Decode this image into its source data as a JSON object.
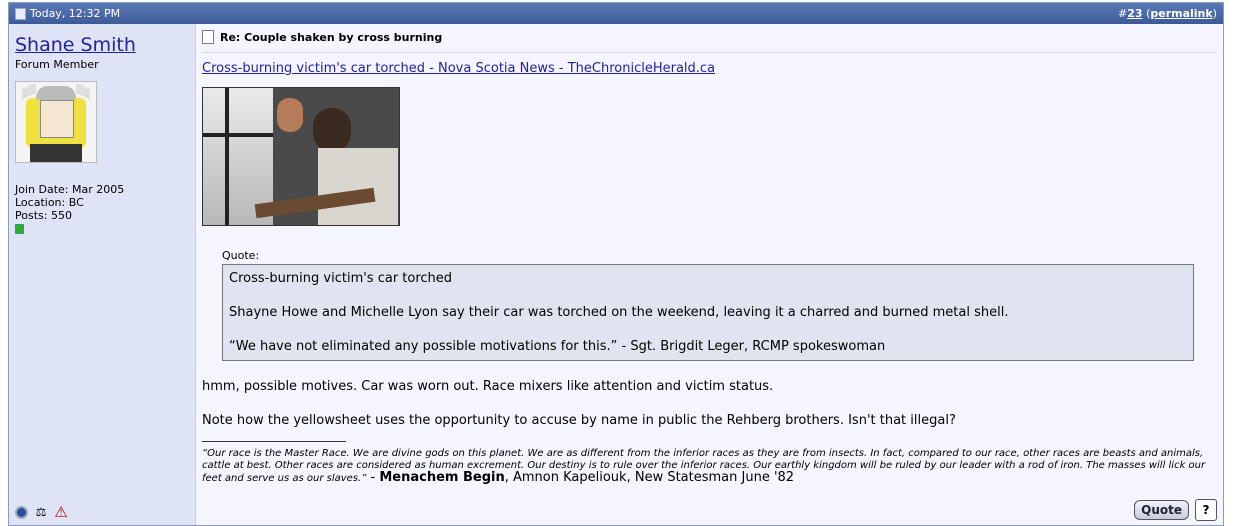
{
  "header": {
    "date": "Today, 12:32 PM",
    "hash": "#",
    "post_number": "23",
    "open_paren": "(",
    "permalink": "permalink",
    "close_paren": ")"
  },
  "user": {
    "name": "Shane Smith",
    "title": "Forum Member",
    "join_date": "Join Date: Mar 2005",
    "location": "Location: BC",
    "posts": "Posts: 550"
  },
  "post": {
    "title": "Re: Couple shaken by cross burning",
    "link_text": "Cross-burning victim's car torched - Nova Scotia News - TheChronicleHerald.ca",
    "quote_label": "Quote:",
    "quote_lines": [
      "Cross-burning victim's car torched",
      "Shayne Howe and Michelle Lyon say their car was torched on the weekend, leaving it a charred and burned metal shell.",
      "“We have not eliminated any possible motivations for this.” - Sgt. Brigdit Leger, RCMP spokeswoman"
    ],
    "paragraphs": [
      "hmm, possible motives. Car was worn out. Race mixers like attention and victim status.",
      "Note how the yellowsheet uses the opportunity to accuse by name in public the Rehberg brothers. Isn't that illegal?"
    ]
  },
  "signature": {
    "quote_text": "“Our race is the Master Race. We are divine gods on this planet. We are as different from the inferior races as they are from insects. In fact, compared to our race, other races are beasts and animals, cattle at best. Other races are considered as human excrement. Our destiny is to rule over the inferior races. Our earthly kingdom will be ruled by our leader with a rod of iron. The masses will lick our feet and serve us as our slaves.”",
    "dash": " - ",
    "author": "Menachem Begin",
    "source": ", Amnon Kapeliouk, New Statesman June '82"
  },
  "buttons": {
    "quote": "Quote",
    "multiquote": "?"
  }
}
